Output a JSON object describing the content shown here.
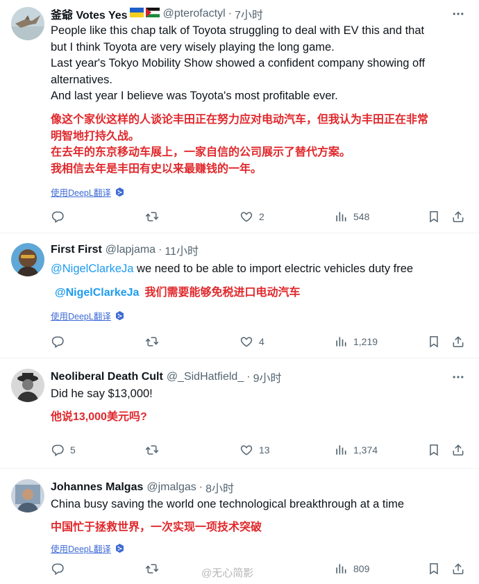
{
  "tweets": [
    {
      "name": "釜爺 Votes Yes",
      "handle": "@pterofactyl",
      "dot": "·",
      "time": "7小时",
      "body": [
        "People like this chap talk of Toyota struggling to deal with EV this and that",
        "but I think Toyota are very wisely playing the long game.",
        "Last year's Tokyo Mobility Show showed a confident company showing off",
        "alternatives.",
        "And last year I believe was Toyota's most profitable ever."
      ],
      "translation": [
        "像这个家伙这样的人谈论丰田正在努力应对电动汽车，但我认为丰田正在非常",
        "明智地打持久战。",
        "在去年的东京移动车展上，一家自信的公司展示了替代方案。",
        "我相信去年是丰田有史以来最赚钱的一年。"
      ],
      "translate_label": "使用DeepL翻译",
      "replies": "",
      "reposts": "",
      "likes": "2",
      "views": "548"
    },
    {
      "name": "First First",
      "handle": "@lapjama",
      "dot": "·",
      "time": "11小时",
      "mention": "@NigelClarkeJa",
      "body_text": " we need to be able to import electric vehicles duty free",
      "translation_mention": "@NigelClarkeJa",
      "translation_text": "我们需要能够免税进口电动汽车",
      "translate_label": "使用DeepL翻译",
      "replies": "",
      "reposts": "",
      "likes": "4",
      "views": "1,219"
    },
    {
      "name": "Neoliberal Death Cult",
      "handle": "@_SidHatfield_",
      "dot": "·",
      "time": "9小时",
      "body": "Did he say $13,000!",
      "translation": "他说13,000美元吗?",
      "replies": "5",
      "reposts": "",
      "likes": "13",
      "views": "1,374"
    },
    {
      "name": "Johannes Malgas",
      "handle": "@jmalgas",
      "dot": "·",
      "time": "8小时",
      "body": "China busy saving the world one technological breakthrough at a time",
      "translation": "中国忙于拯救世界，一次实现一项技术突破",
      "translate_label": "使用DeepL翻译",
      "replies": "",
      "reposts": "",
      "likes": "",
      "views": "809"
    }
  ],
  "watermark": "@无心简影",
  "icons": {
    "reply": "reply-icon",
    "repost": "repost-icon",
    "like": "heart-icon",
    "views": "views-icon",
    "bookmark": "bookmark-icon",
    "share": "share-icon",
    "more": "more-icon",
    "translate_badge": "translate-badge-icon"
  },
  "colors": {
    "translation": "#e0282c",
    "mention": "#1d9bf0",
    "muted": "#536471",
    "link": "#3e6bd6"
  }
}
